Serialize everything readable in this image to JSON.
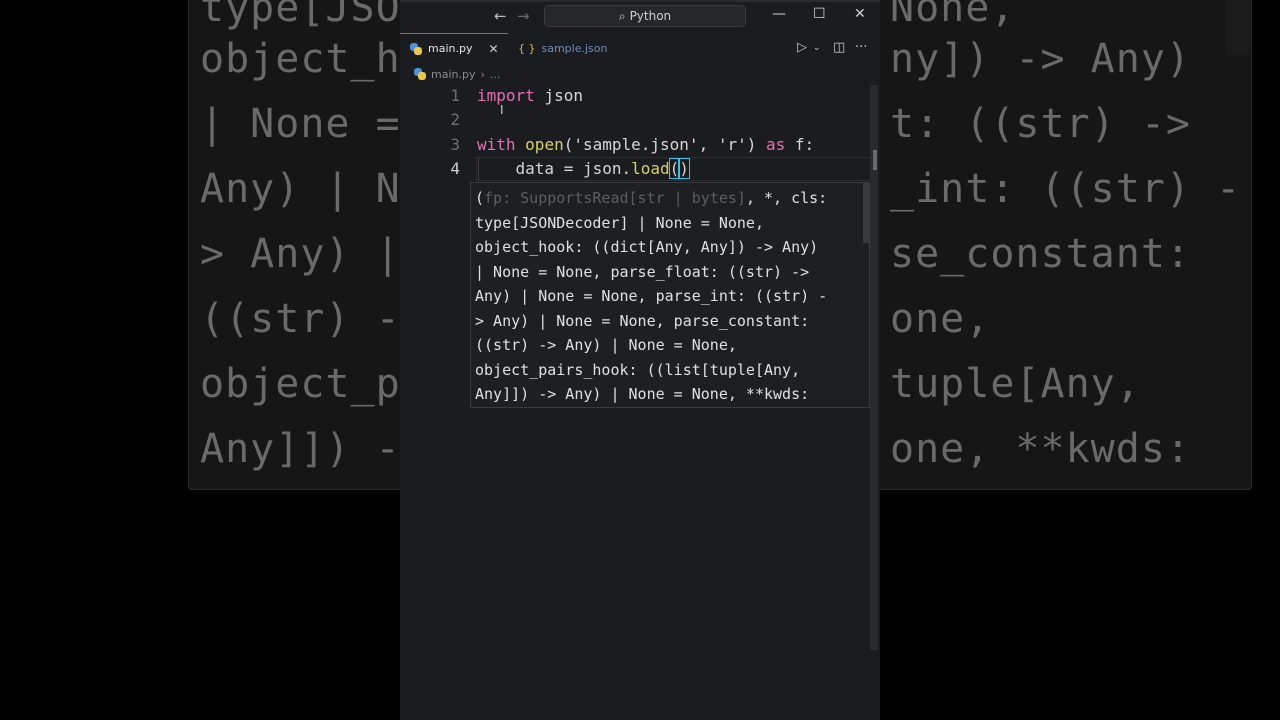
{
  "background_text": {
    "left_lines": [
      "type[JSO",
      "object_h",
      "| None =",
      "Any) | N",
      "> Any) |",
      "((str) -",
      "object_p",
      "Any]]) -"
    ],
    "right_lines": [
      "None,",
      "ny]) -> Any)",
      "t: ((str) ->",
      "_int: ((str) -",
      "se_constant:",
      "one,",
      "tuple[Any,",
      "one, **kwds:"
    ]
  },
  "titlebar": {
    "back_icon": "arrow-left-icon",
    "forward_icon": "arrow-right-icon",
    "search_label": "Python",
    "minimize": "—",
    "maximize": "☐",
    "close": "✕"
  },
  "tabs": [
    {
      "label": "main.py",
      "icon": "python-file-icon",
      "active": true
    },
    {
      "label": "sample.json",
      "icon": "json-file-icon",
      "active": false
    }
  ],
  "breadcrumb": {
    "file": "main.py",
    "sep": "›",
    "more": "..."
  },
  "code": {
    "line_numbers": [
      "1",
      "2",
      "3",
      "4"
    ],
    "l1_kw": "import",
    "l1_rest": " json",
    "l3_kw": "with",
    "l3_fn": "open",
    "l3_args": "('sample.json', 'r') ",
    "l3_as": "as",
    "l3_rest": " f:",
    "l4_pre": "    data = json.",
    "l4_fn": "load",
    "l4_open": "(",
    "l4_close": ")"
  },
  "signature_help": {
    "open": "(",
    "dim": "fp: SupportsRead[str | bytes]",
    "first_rest": ", *, cls:",
    "lines": [
      "type[JSONDecoder] | None = None,",
      "object_hook: ((dict[Any, Any]) -> Any)",
      "| None = None, parse_float: ((str) ->",
      "Any) | None = None, parse_int: ((str) -",
      "> Any) | None = None, parse_constant:",
      "((str) -> Any) | None = None,",
      "object_pairs_hook: ((list[tuple[Any,",
      "Any]]) -> Any) | None = None, **kwds:"
    ]
  }
}
